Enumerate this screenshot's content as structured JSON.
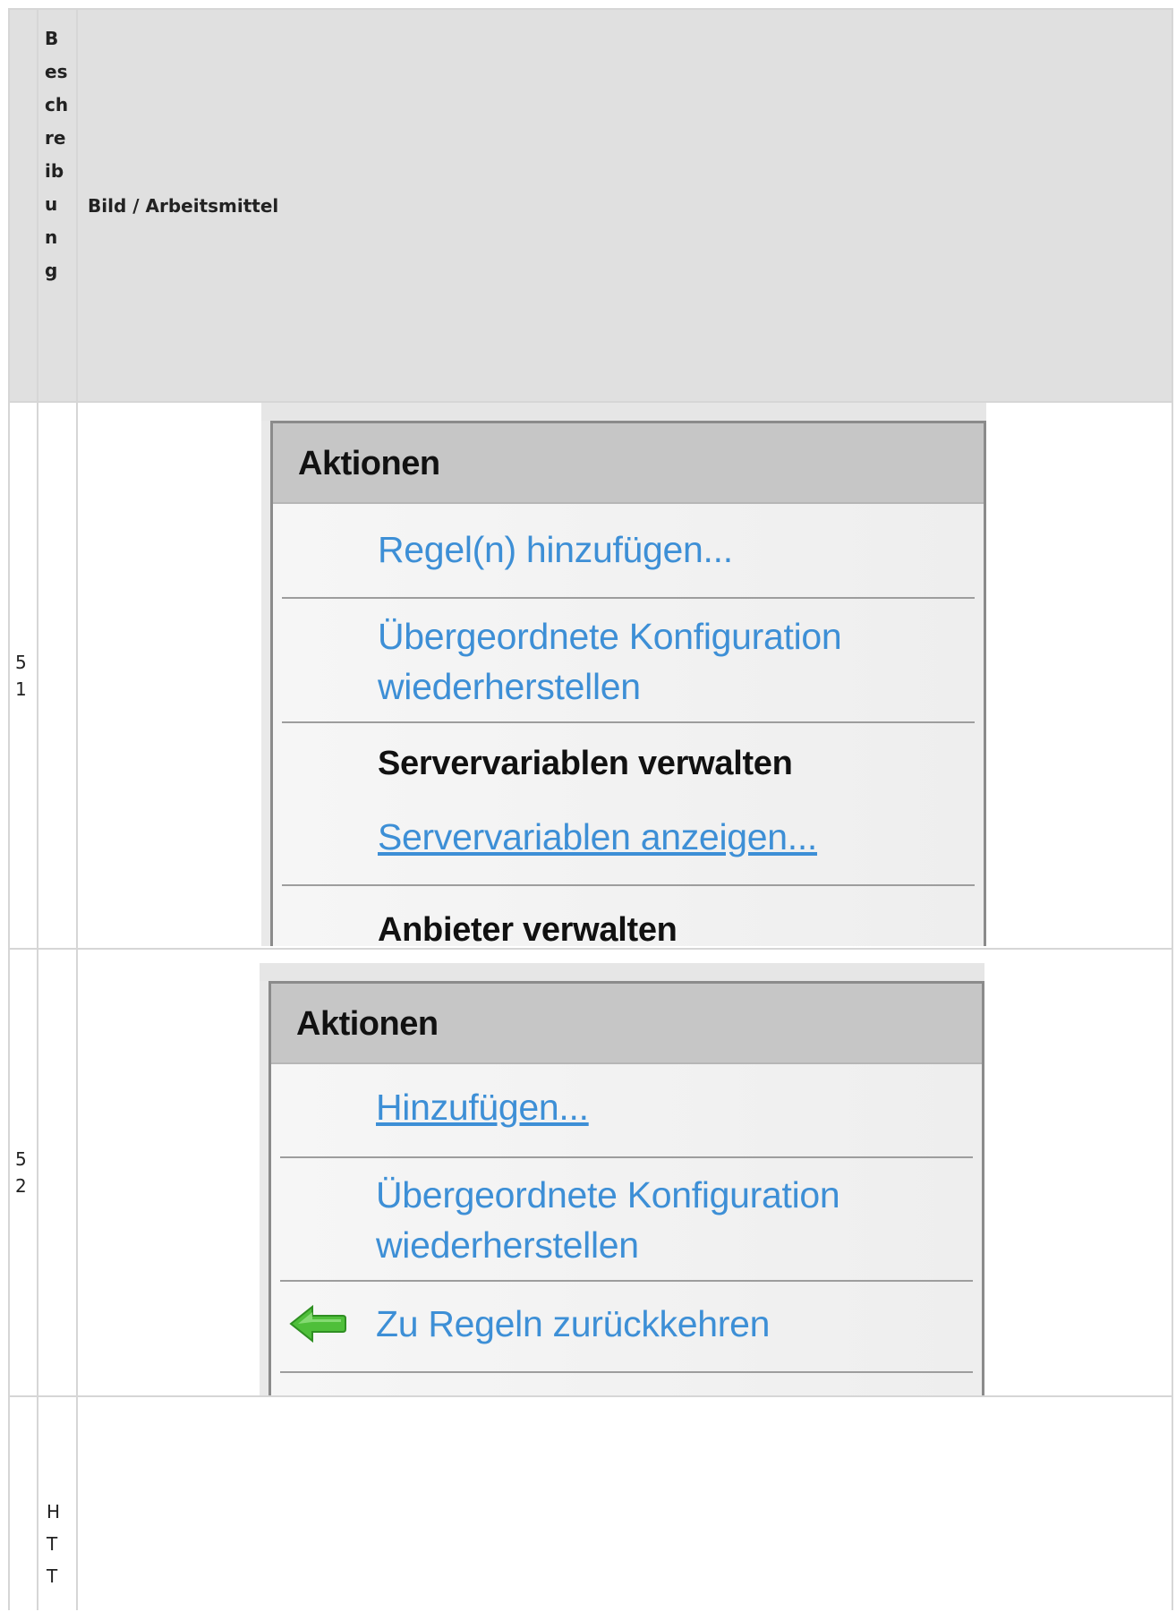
{
  "table": {
    "header": {
      "col1": "",
      "col2": "Beschreibung",
      "col3": "Bild / Arbeitsmittel"
    },
    "rows": [
      {
        "number": "51",
        "description": "",
        "panel": {
          "title": "Aktionen",
          "items": [
            {
              "label": "Regel(n) hinzufügen...",
              "kind": "link"
            },
            {
              "label": "Übergeordnete Konfiguration wiederherstellen",
              "kind": "link"
            },
            {
              "label": "Servervariablen verwalten",
              "kind": "section"
            },
            {
              "label": "Servervariablen anzeigen...",
              "kind": "link-underlined"
            },
            {
              "label": "Anbieter verwalten",
              "kind": "section"
            }
          ]
        }
      },
      {
        "number": "52",
        "description": "",
        "panel": {
          "title": "Aktionen",
          "items": [
            {
              "label": "Hinzufügen...",
              "kind": "link-underlined"
            },
            {
              "label": "Übergeordnete Konfiguration wiederherstellen",
              "kind": "link"
            },
            {
              "label": "Zu Regeln zurückkehren",
              "kind": "link",
              "icon": "green-back-arrow-icon"
            }
          ]
        }
      },
      {
        "number": "",
        "description": "HTT",
        "panel": null
      }
    ]
  },
  "colors": {
    "grid": "#d6d6d6",
    "header_bg": "#e0e0e0",
    "link": "#3d8fd6",
    "panel_header": "#c6c6c6",
    "arrow": "#4fbf3a"
  }
}
